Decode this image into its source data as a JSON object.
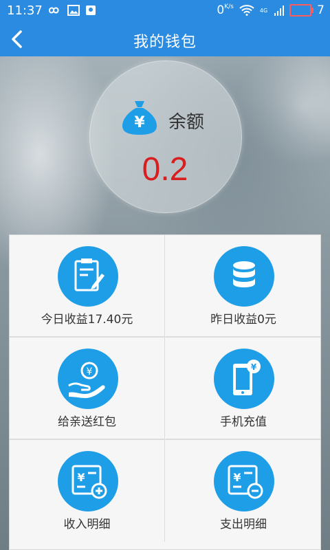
{
  "status": {
    "time": "11:37",
    "speed": "0",
    "speed_unit": "K/s",
    "network": "4G",
    "battery": "7"
  },
  "header": {
    "title": "我的钱包"
  },
  "balance": {
    "label": "余额",
    "value": "0.2"
  },
  "grid": [
    {
      "label": "今日收益17.40元",
      "icon": "clipboard-icon"
    },
    {
      "label": "昨日收益0元",
      "icon": "coin-stack-icon"
    },
    {
      "label": "给亲送红包",
      "icon": "gift-money-icon"
    },
    {
      "label": "手机充值",
      "icon": "phone-recharge-icon"
    },
    {
      "label": "收入明细",
      "icon": "income-detail-icon"
    },
    {
      "label": "支出明细",
      "icon": "expense-detail-icon"
    }
  ],
  "colors": {
    "primary": "#2b8be0",
    "icon_circle": "#1f9ee8",
    "balance_value": "#d81e1e"
  }
}
